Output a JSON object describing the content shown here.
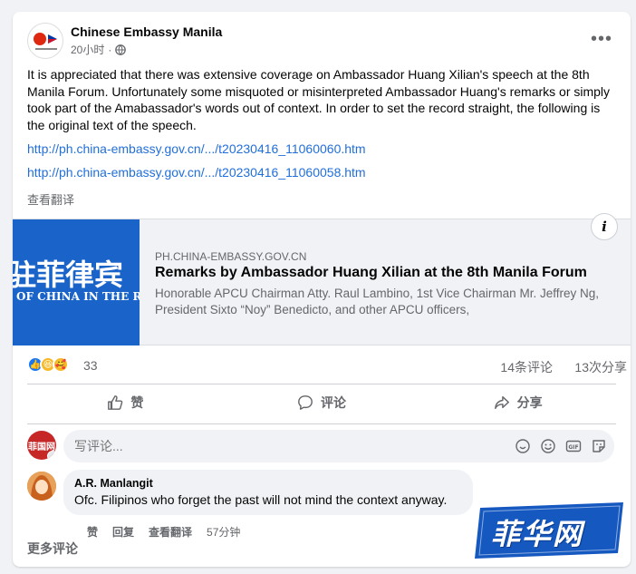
{
  "post": {
    "page_name": "Chinese Embassy Manila",
    "time": "20小时",
    "separator": "·",
    "body": "It is appreciated that there was extensive coverage on Ambassador Huang Xilian's speech at the 8th Manila Forum. Unfortunately some misquoted or misinterpreted Ambassador Huang's remarks or simply took part of the Amabassador's words out of context. In order to set the record straight, the following is the original text of the speech.",
    "links": [
      "http://ph.china-embassy.gov.cn/.../t20230416_11060060.htm",
      "http://ph.china-embassy.gov.cn/.../t20230416_11060058.htm"
    ],
    "see_translation": "查看翻译"
  },
  "preview": {
    "image_text_cn": "驻菲律宾",
    "image_text_en": "OF CHINA IN THE R",
    "domain": "PH.CHINA-EMBASSY.GOV.CN",
    "title": "Remarks by Ambassador Huang Xilian at the 8th Manila Forum",
    "description": "Honorable APCU Chairman Atty. Raul Lambino, 1st  Vice Chairman Mr. Jeffrey Ng, President Sixto “Noy” Benedicto, and other APCU officers,",
    "info_label": "i"
  },
  "stats": {
    "reaction_count": "33",
    "comments": "14条评论",
    "shares": "13次分享"
  },
  "actions": {
    "like": "赞",
    "comment": "评论",
    "share": "分享"
  },
  "composer": {
    "avatar_text": "菲国网",
    "placeholder": "写评论..."
  },
  "comments": [
    {
      "author": "A.R. Manlangit",
      "text": "Ofc. Filipinos who forget the past will not mind the context anyway.",
      "like": "赞",
      "reply": "回复",
      "translate": "查看翻译",
      "time": "57分钟"
    }
  ],
  "more_comments": "更多评论",
  "watermark": "菲华网",
  "colors": {
    "link": "#216fdb",
    "like_blue": "#1877f2",
    "preview_blue": "#1a63c9"
  }
}
